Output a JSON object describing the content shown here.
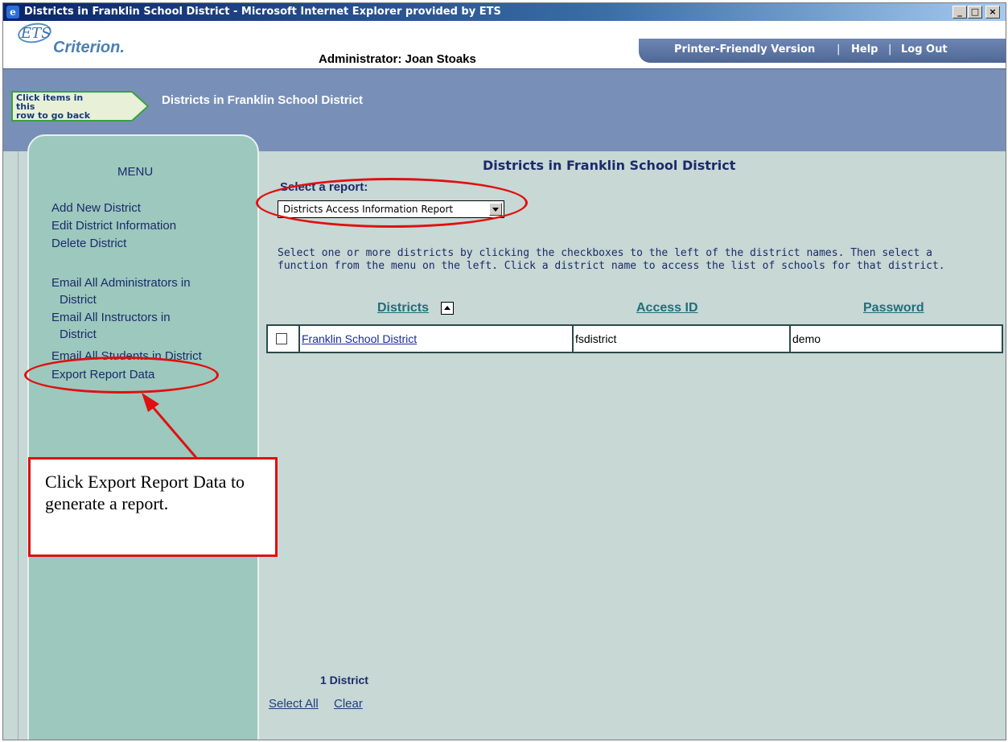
{
  "window": {
    "title": "Districts in Franklin School District - Microsoft Internet Explorer provided by ETS",
    "buttons": {
      "minimize": "_",
      "maximize": "□",
      "close": "×"
    }
  },
  "header": {
    "logo_ets": "ETS",
    "logo_product": "Criterion.",
    "admin_label": "Administrator: Joan Stoaks",
    "links": {
      "printer": "Printer-Friendly Version",
      "separator": "|",
      "help": "Help",
      "logout": "Log Out"
    }
  },
  "breadcrumb": {
    "back_label_line1": "Click items in this",
    "back_label_line2": "row to go back",
    "current": "Districts in Franklin School District"
  },
  "menu": {
    "title": "MENU",
    "items": [
      "Add New District",
      "Edit District Information",
      "Delete District",
      "Email All Administrators in",
      "District",
      "Email All Instructors in",
      "District",
      "Email All Students in District",
      "Export Report Data"
    ]
  },
  "main": {
    "title": "Districts in Franklin School District",
    "report_label": "Select a report:",
    "report_selected": "Districts Access Information Report",
    "instructions_line1": "Select one or more districts by clicking the checkboxes to the left of the district names. Then select a",
    "instructions_line2": "function from the menu on the left. Click a district name to access the list of schools for that district.",
    "table": {
      "headers": [
        "Districts",
        "Access ID",
        "Password"
      ],
      "rows": [
        {
          "name": "Franklin School District",
          "access_id": "fsdistrict",
          "password": "demo",
          "checked": false
        }
      ]
    },
    "count": "1 District",
    "select_all": "Select All",
    "clear": "Clear"
  },
  "annotation": {
    "callout_text": "Click Export Report Data to generate a report.",
    "color": "#e01010"
  }
}
